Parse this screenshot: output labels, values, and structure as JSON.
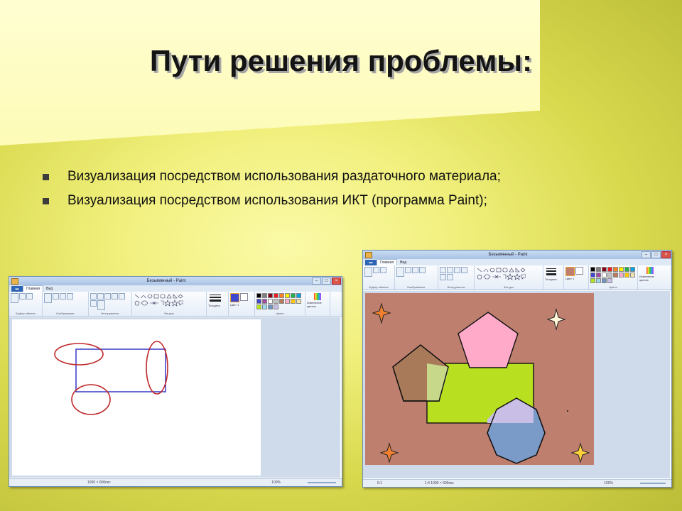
{
  "slide": {
    "title": "Пути решения проблемы:",
    "bullets": [
      "Визуализация посредством использования раздаточного материала;",
      "Визуализация посредством использования ИКТ (программа Paint);"
    ]
  },
  "paint_left": {
    "title": "Безымянный - Paint",
    "file_tab": "▬",
    "tabs": [
      "Главная",
      "Вид"
    ],
    "ribbon_groups": [
      "Буфер обмена",
      "Изображение",
      "Инструменты",
      "Фигуры",
      "Цвета"
    ],
    "size_label": "Толщина",
    "color1_label": "Цвет 1",
    "color2_label": "Цвет 2",
    "edit_colors": "Изменение цветов",
    "status_size": "1000 × 600пкс",
    "zoom": "100%",
    "palette": [
      "#000000",
      "#7f7f7f",
      "#880015",
      "#ed1c24",
      "#ff7f27",
      "#fff200",
      "#22b14c",
      "#00a2e8",
      "#3f48cc",
      "#a349a4",
      "#ffffff",
      "#c3c3c3",
      "#b97a57",
      "#ffaec9",
      "#ffc90e",
      "#efe4b0",
      "#b5e61d",
      "#99d9ea",
      "#7092be",
      "#c8bfe7"
    ]
  },
  "paint_right": {
    "title": "Безымянный - Paint",
    "file_tab": "▬",
    "tabs": [
      "Главная",
      "Вид"
    ],
    "ribbon_groups": [
      "Буфер обмена",
      "Изображение",
      "Инструменты",
      "Фигуры",
      "Цвета"
    ],
    "size_label": "Толщина",
    "color1_label": "Цвет 1",
    "color2_label": "Цвет 2",
    "edit_colors": "Изменение цветов",
    "status_pos": "5:1",
    "status_size": "1:4 1000 × 600пкс",
    "zoom": "100%",
    "palette": [
      "#000000",
      "#7f7f7f",
      "#880015",
      "#ed1c24",
      "#ff7f27",
      "#fff200",
      "#22b14c",
      "#00a2e8",
      "#3f48cc",
      "#a349a4",
      "#ffffff",
      "#c3c3c3",
      "#b97a57",
      "#ffaec9",
      "#ffc90e",
      "#efe4b0",
      "#b5e61d",
      "#99d9ea",
      "#7092be",
      "#c8bfe7"
    ]
  },
  "colors": {
    "canvas_brown": "#bf7f6f",
    "rect_green": "#b8e020",
    "pentagon_pink": "#ffaac8",
    "pentagon_brown": "#a87a5a",
    "hexagon_blue": "#7a9ac8",
    "hexagon_overlap": "#c8bee6",
    "star_orange": "#f08030",
    "star_yellow": "#ffd23c",
    "star_cream": "#fff8d8",
    "drawing_red": "#c0282a",
    "drawing_blue": "#3838c8"
  }
}
